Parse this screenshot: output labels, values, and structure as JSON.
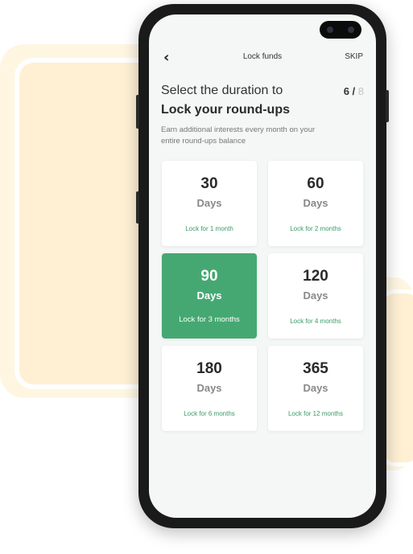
{
  "header": {
    "title": "Lock funds",
    "skip_label": "SKIP"
  },
  "heading": {
    "line1": "Select the duration to",
    "line2": "Lock your round-ups",
    "step_current": "6",
    "step_separator": " / ",
    "step_total": "8"
  },
  "subtitle": "Earn additional interests every month on your entire round-ups balance",
  "options": [
    {
      "days": "30",
      "unit": "Days",
      "lock_label": "Lock for 1 month",
      "selected": false
    },
    {
      "days": "60",
      "unit": "Days",
      "lock_label": "Lock for 2 months",
      "selected": false
    },
    {
      "days": "90",
      "unit": "Days",
      "lock_label": "Lock for 3 months",
      "selected": true
    },
    {
      "days": "120",
      "unit": "Days",
      "lock_label": "Lock for 4 months",
      "selected": false
    },
    {
      "days": "180",
      "unit": "Days",
      "lock_label": "Lock for 6 months",
      "selected": false
    },
    {
      "days": "365",
      "unit": "Days",
      "lock_label": "Lock for 12 months",
      "selected": false
    }
  ],
  "colors": {
    "accent": "#45a872",
    "background_deco": "#fff0d4"
  },
  "icons": {
    "back": "chevron-left-icon"
  }
}
